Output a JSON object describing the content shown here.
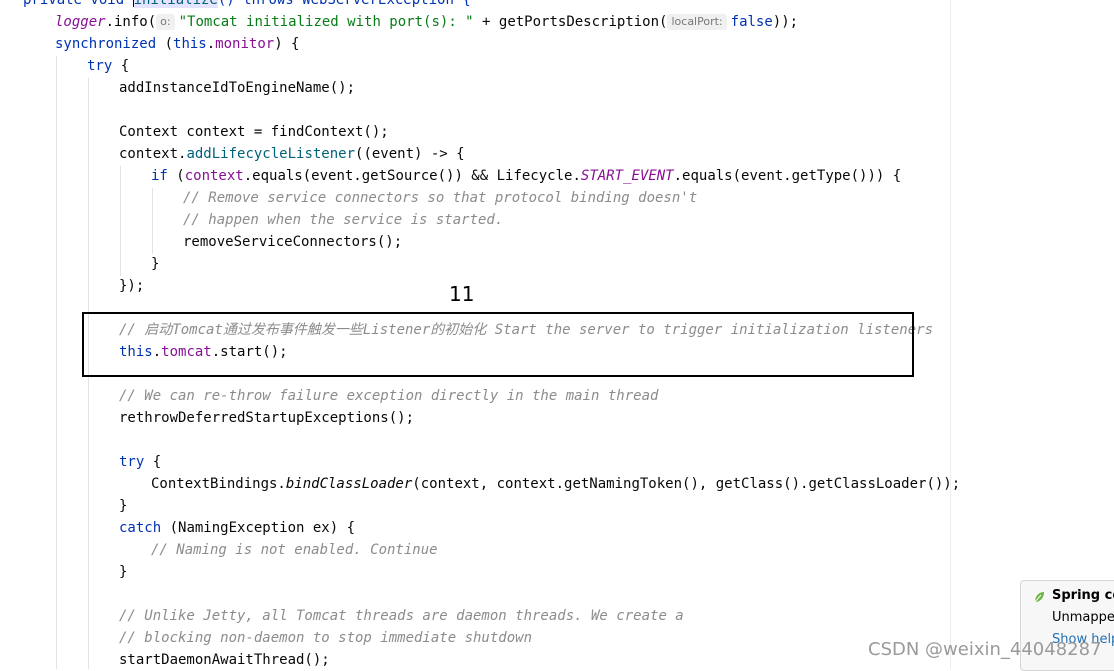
{
  "code": {
    "l0": {
      "a": "private void ",
      "b": "initialize",
      "c": "() throws WebServerException {"
    },
    "l1": {
      "a": "logger",
      "b": ".info(",
      "hint": "o:",
      "c": "\"Tomcat initialized with port(s): \"",
      "d": " + getPortsDescription(",
      "hint2": "localPort:",
      "e": "false",
      "f": "));"
    },
    "l2": {
      "a": "synchronized",
      "b": " (",
      "c": "this",
      "d": ".",
      "e": "monitor",
      "f": ") {"
    },
    "l3": {
      "a": "try",
      "b": " {"
    },
    "l4": "addInstanceIdToEngineName();",
    "l5": "Context context = findContext();",
    "l6": {
      "a": "context.",
      "b": "addLifecycleListener",
      "c": "((event) -> {"
    },
    "l7": {
      "a": "if",
      "b": " (",
      "c": "context",
      "d": ".equals(event.getSource()) && Lifecycle.",
      "e": "START_EVENT",
      "f": ".equals(event.getType())) {"
    },
    "l8": "// Remove service connectors so that protocol binding doesn't",
    "l9": "// happen when the service is started.",
    "l10": "removeServiceConnectors();",
    "l11": "}",
    "l12": "});",
    "l13": "// 启动Tomcat通过发布事件触发一些Listener的初始化 Start the server to trigger initialization listeners",
    "l14": {
      "a": "this",
      "b": ".",
      "c": "tomcat",
      "d": ".start();"
    },
    "l15": "// We can re-throw failure exception directly in the main thread",
    "l16": "rethrowDeferredStartupExceptions();",
    "l17": {
      "a": "try",
      "b": " {"
    },
    "l18": {
      "a": "ContextBindings.",
      "b": "bindClassLoader",
      "c": "(context, context.getNamingToken(), getClass().getClassLoader());"
    },
    "l19": "}",
    "l20": {
      "a": "catch",
      "b": " (NamingException ex) {"
    },
    "l21": "// Naming is not enabled. Continue",
    "l22": "}",
    "l23": "// Unlike Jetty, all Tomcat threads are daemon threads. We create a",
    "l24": "// blocking non-daemon to stop immediate shutdown",
    "l25": "startDaemonAwaitThread();"
  },
  "annotation": {
    "number": "11"
  },
  "notification": {
    "title": "Spring cor",
    "body": "Unmapped",
    "link": "Show help"
  },
  "watermark": "CSDN @weixin_44048287",
  "colors": {
    "keyword": "#0033b3",
    "field": "#871094",
    "string": "#067d17",
    "comment": "#8c8c8c"
  }
}
